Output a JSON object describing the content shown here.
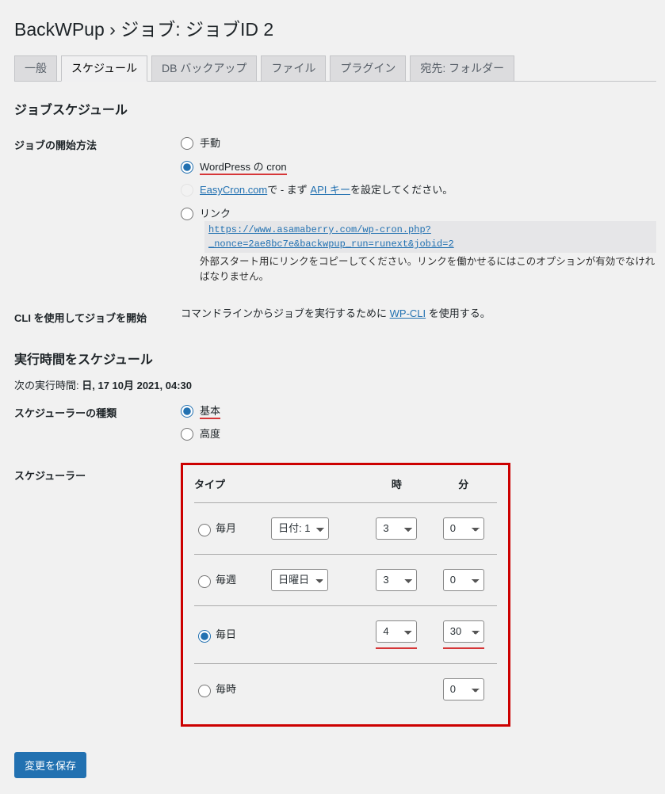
{
  "page_title": "BackWPup › ジョブ: ジョブID 2",
  "tabs": [
    "一般",
    "スケジュール",
    "DB バックアップ",
    "ファイル",
    "プラグイン",
    "宛先: フォルダー"
  ],
  "active_tab": 1,
  "section_schedule": "ジョブスケジュール",
  "start_method": {
    "label": "ジョブの開始方法",
    "manual": "手動",
    "wpcron": "WordPress の cron",
    "easycron_prefix": "",
    "easycron_link": "EasyCron.com",
    "easycron_mid": "で - まず ",
    "easycron_apikey": "API キー",
    "easycron_suffix": "を設定してください。",
    "link_label": "リンク",
    "link_url": "https://www.asamaberry.com/wp-cron.php?_nonce=2ae8bc7e&backwpup_run=runext&jobid=2",
    "link_note": "外部スタート用にリンクをコピーしてください。リンクを働かせるにはこのオプションが有効でなければなりません。"
  },
  "cli": {
    "label": "CLI を使用してジョブを開始",
    "pre": "コマンドラインからジョブを実行するために ",
    "link": "WP-CLI",
    "post": " を使用する。"
  },
  "section_time": "実行時間をスケジュール",
  "next_run_label": "次の実行時間: ",
  "next_run_value": "日, 17 10月 2021, 04:30",
  "scheduler_type": {
    "label": "スケジューラーの種類",
    "basic": "基本",
    "advanced": "高度"
  },
  "scheduler": {
    "label": "スケジューラー",
    "col_type": "タイプ",
    "col_hour": "時",
    "col_min": "分",
    "monthly": "毎月",
    "weekly": "毎週",
    "daily": "毎日",
    "hourly": "毎時",
    "date_sel": "日付: 1",
    "weekday_sel": "日曜日",
    "h_monthly": "3",
    "m_monthly": "0",
    "h_weekly": "3",
    "m_weekly": "0",
    "h_daily": "4",
    "m_daily": "30",
    "m_hourly": "0"
  },
  "save_button": "変更を保存"
}
